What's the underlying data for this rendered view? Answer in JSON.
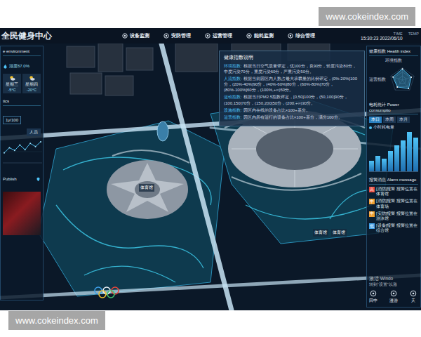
{
  "watermarks": [
    "www.cokeindex.com",
    "www.cokeindex.com"
  ],
  "header": {
    "title": "全民健身中心",
    "nav": [
      {
        "label": "设备监测",
        "selected": false
      },
      {
        "label": "安防管理",
        "selected": false
      },
      {
        "label": "运营管理",
        "selected": false
      },
      {
        "label": "能耗监测",
        "selected": false
      },
      {
        "label": "综合管理",
        "selected": false
      }
    ],
    "time_label": "TIME",
    "time": "15:30:23 2022/06/10",
    "temp_label": "TEMP"
  },
  "left_panel": {
    "environment": {
      "title": "e environment",
      "humidity": "湿度67.0%",
      "weather": [
        {
          "day": "星期三",
          "temp": "-5°C"
        },
        {
          "day": "星期四",
          "temp": "-20°C"
        }
      ]
    },
    "statistics": {
      "title": "tics",
      "value": "1y/100",
      "button": "人员",
      "series": [
        22,
        35,
        28,
        42,
        30,
        46,
        38,
        50
      ]
    },
    "publish": {
      "label": "Publish"
    }
  },
  "map": {
    "main_label": "体育馆",
    "side_labels": [
      "体育馆",
      "体育馆"
    ]
  },
  "popup": {
    "title": "健康指数说明",
    "items": [
      {
        "label": "环境指数:",
        "text": "根据当日空气质量评定，优100分，良90分，轻度污染80分，中度污染70分，重度污染60分，严重污染50分。"
      },
      {
        "label": "人流指数:",
        "text": "根据当前园区内人数占最大承载量的比例评定，(0%-20%]100分，(20%-40%]90分，(40%-60%]80分，(60%-80%]70分，(80%-100%]60分，(100%,+∞)50分。"
      },
      {
        "label": "运动指数:",
        "text": "根据当日PM2.5指数评定，[0,50]100分，(50,100]90分，(100,150]70分，(150,200]50分，(200,+∞)30分。"
      },
      {
        "label": "设施指数:",
        "text": "园区内在线的设备占比×100+基分。"
      },
      {
        "label": "运营指数:",
        "text": "园区内所有运行的设备占比×100+基分，满分100分。"
      }
    ]
  },
  "right_panel": {
    "health": {
      "title": "健康指数",
      "title_en": "Health index",
      "labels": [
        "环境指数",
        "运营指数"
      ],
      "values": [
        90,
        75,
        85,
        70,
        80
      ]
    },
    "power": {
      "title": "电耗统计",
      "title_en": "Power consumptio",
      "tabs": [
        {
          "label": "本日",
          "selected": true
        },
        {
          "label": "本周",
          "selected": false
        },
        {
          "label": "本月",
          "selected": false
        }
      ],
      "legend": "小时耗电量",
      "values": [
        2,
        3,
        2.5,
        4,
        5,
        6,
        7.5,
        6.5
      ]
    },
    "alarms": {
      "title": "报警消息",
      "title_en": "Alarm message",
      "items": [
        {
          "tag": "高",
          "text": "[消防]报警 报警位置在体育馆",
          "color": "#e8463a"
        },
        {
          "tag": "中",
          "text": "[消防]报警 报警位置在体育场",
          "color": "#f0a030"
        },
        {
          "tag": "中",
          "text": "[安防]报警 报警位置在游泳馆",
          "color": "#f0a030"
        },
        {
          "tag": "低",
          "text": "[设备]报警 报警位置在综合馆",
          "color": "#3fa0e8"
        }
      ]
    },
    "activation": {
      "title": "激活 Windo",
      "hint": "转到“设置”以激"
    },
    "toolbar": [
      {
        "label": "回中"
      },
      {
        "label": "漫游"
      },
      {
        "label": "天"
      }
    ]
  }
}
